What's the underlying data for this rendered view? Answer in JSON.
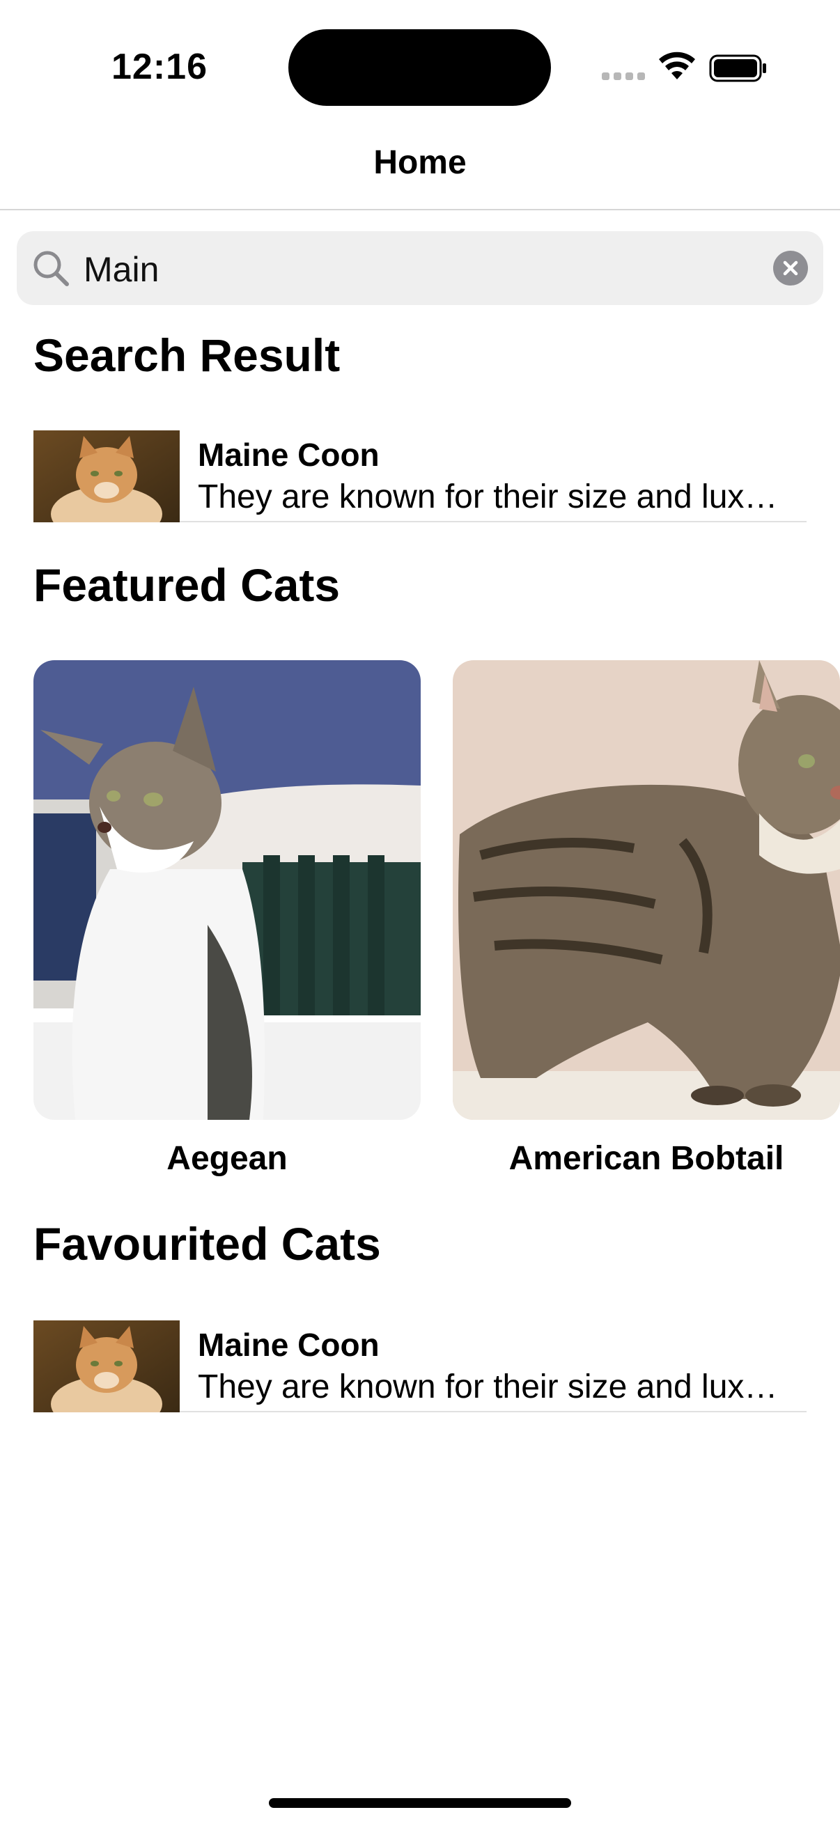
{
  "status": {
    "time": "12:16"
  },
  "nav": {
    "title": "Home"
  },
  "search": {
    "value": "Main"
  },
  "sections": {
    "search_result": "Search Result",
    "featured": "Featured Cats",
    "favourited": "Favourited Cats"
  },
  "search_results": [
    {
      "name": "Maine Coon",
      "description": "They are known for their size and lux…"
    }
  ],
  "featured": [
    {
      "name": "Aegean"
    },
    {
      "name": "American Bobtail"
    }
  ],
  "favourites": [
    {
      "name": "Maine Coon",
      "description": "They are known for their size and lux…"
    }
  ],
  "colors": {
    "search_bg": "#efefef",
    "divider": "#d6d6d6",
    "clear_button": "#8e8e93"
  },
  "icons": [
    "search-icon",
    "clear-icon",
    "wifi-icon",
    "battery-icon",
    "signal-icon"
  ]
}
